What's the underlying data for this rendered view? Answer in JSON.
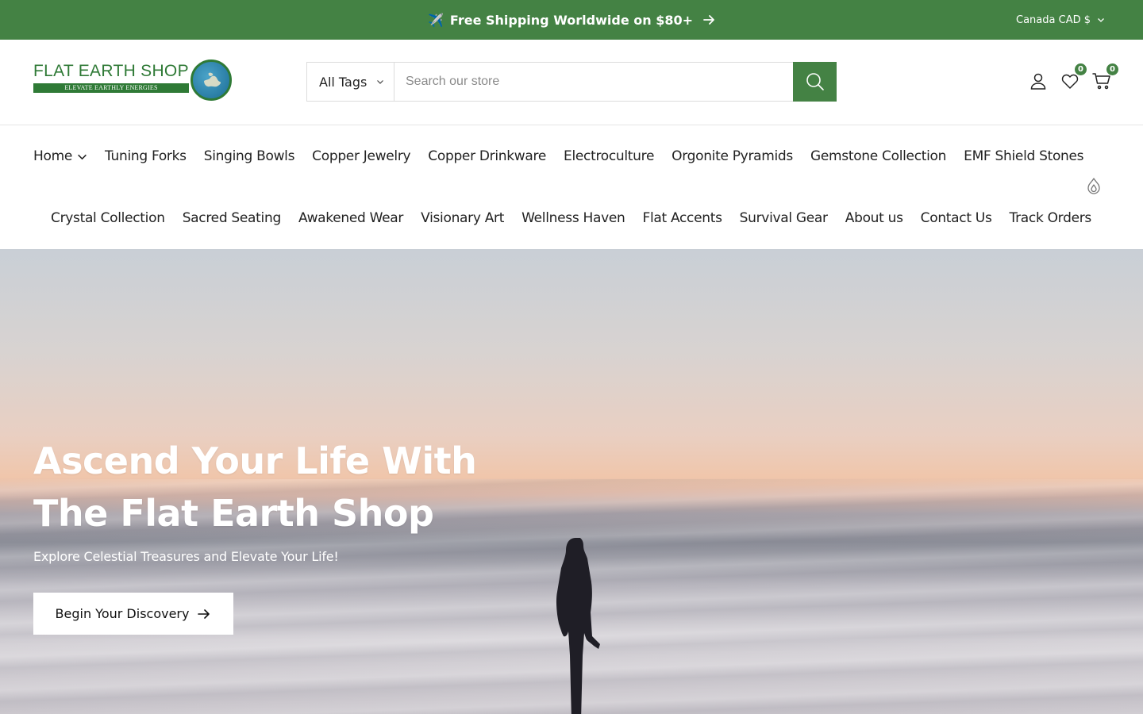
{
  "announcement": {
    "icon": "airplane-icon",
    "text": "Free Shipping Worldwide on $80+",
    "arrow_icon": "arrow-right-icon"
  },
  "currency": {
    "label": "Canada CAD $"
  },
  "logo": {
    "name": "FLAT EARTH SHOP",
    "tagline": "ELEVATE EARTHLY ENERGIES"
  },
  "search": {
    "category": "All Tags",
    "placeholder": "Search our store"
  },
  "header_icons": {
    "wishlist_count": "0",
    "cart_count": "0"
  },
  "nav": {
    "row1": [
      "Home",
      "Tuning Forks",
      "Singing Bowls",
      "Copper Jewelry",
      "Copper Drinkware",
      "Electroculture",
      "Orgonite Pyramids",
      "Gemstone Collection",
      "EMF Shield Stones"
    ],
    "row2": [
      "Crystal Collection",
      "Sacred Seating",
      "Awakened Wear",
      "Visionary Art",
      "Wellness Haven",
      "Flat Accents",
      "Survival Gear",
      "About us",
      "Contact Us",
      "Track Orders"
    ]
  },
  "hero": {
    "title_line1": "Ascend Your Life With",
    "title_line2": "The Flat Earth Shop",
    "subtitle": "Explore Celestial Treasures and Elevate Your Life!",
    "button": "Begin Your Discovery"
  },
  "colors": {
    "brand_green": "#448244",
    "logo_green": "#2f7a36"
  }
}
